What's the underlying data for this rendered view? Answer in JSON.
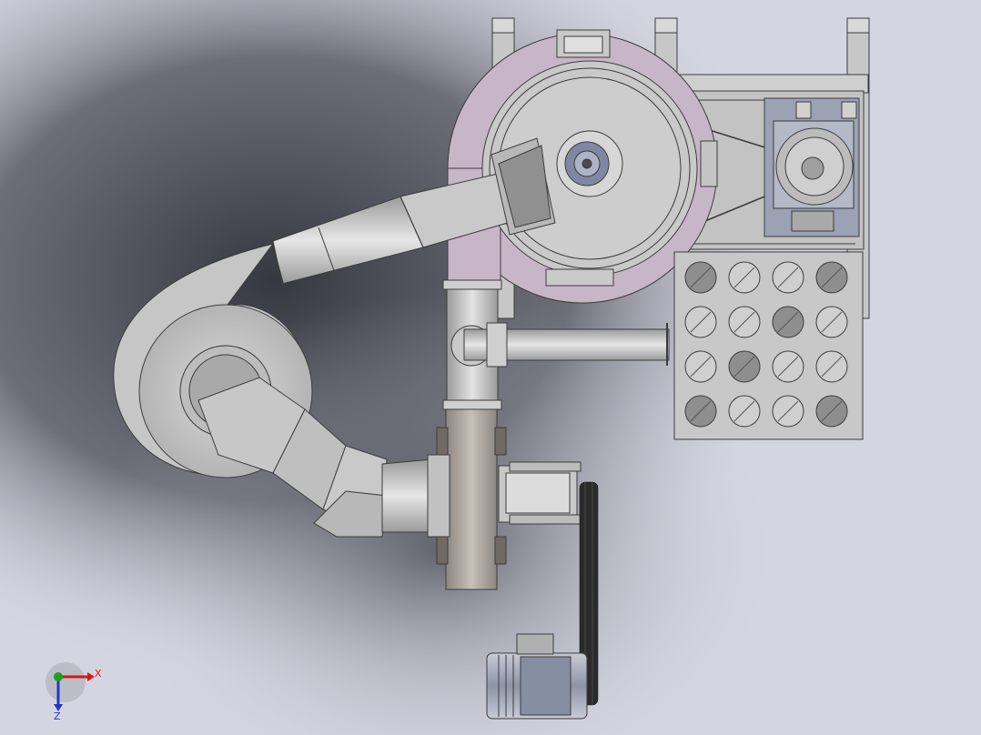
{
  "viewport": {
    "background_colors": {
      "light": "#d4d5e0",
      "shadow": "#2e2f37",
      "edge": "#a9aab5"
    }
  },
  "model_colors": {
    "steel": "#c7c7c7",
    "steel_dark": "#8e8e8e",
    "outline": "#3c3c3c",
    "classifier_body": "#c7b6c7",
    "fan_housing": "#a8a29b",
    "motor_frame": "#9aa2b3",
    "belt": "#2b2b2b"
  },
  "triad": {
    "x_label": "X",
    "z_label": "Z",
    "x_color": "#d11a1a",
    "y_color": "#1aa31a",
    "z_color": "#2236c9"
  }
}
